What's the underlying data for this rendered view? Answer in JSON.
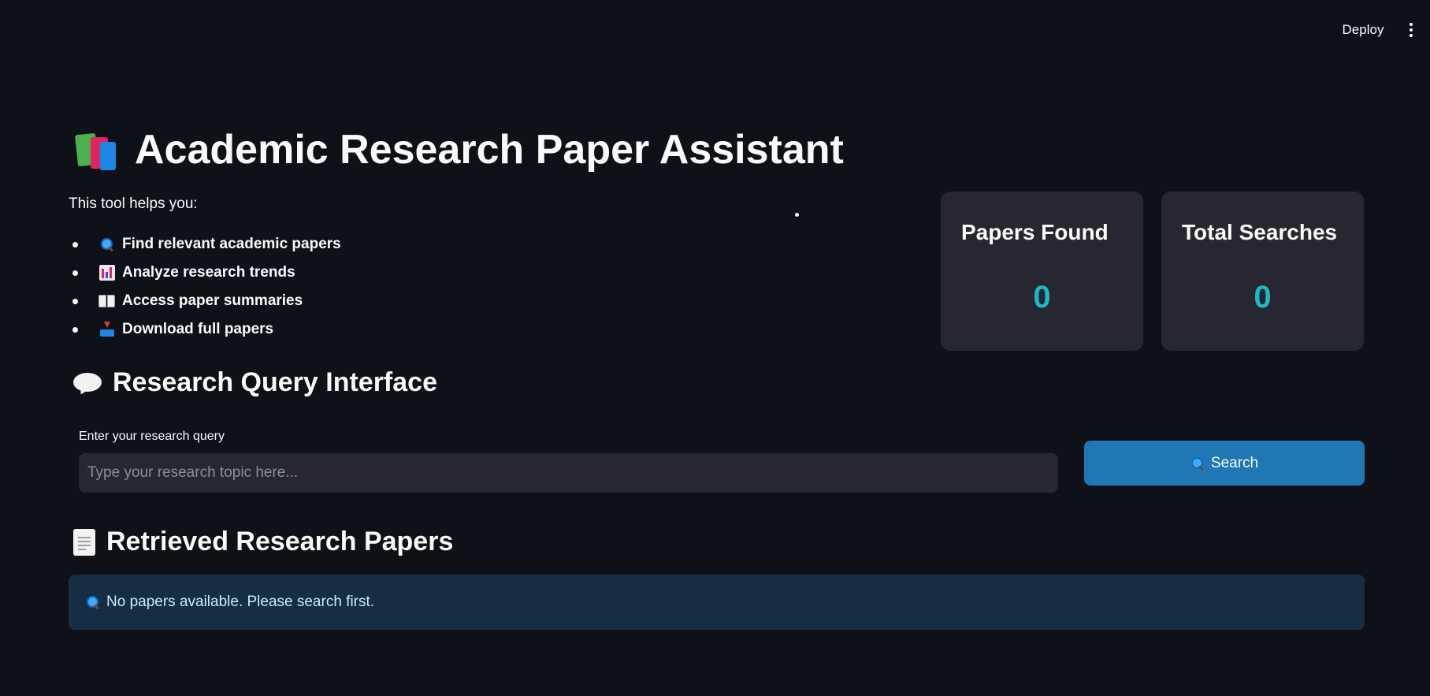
{
  "header": {
    "deploy_label": "Deploy"
  },
  "page": {
    "title": "Academic Research Paper Assistant",
    "title_icon": "books-icon",
    "intro": "This tool helps you:",
    "features": [
      {
        "icon": "magnifier-icon",
        "label": "Find relevant academic papers"
      },
      {
        "icon": "bar-chart-icon",
        "label": "Analyze research trends"
      },
      {
        "icon": "open-book-icon",
        "label": "Access paper summaries"
      },
      {
        "icon": "inbox-tray-icon",
        "label": "Download full papers"
      }
    ]
  },
  "metrics": [
    {
      "label": "Papers Found",
      "value": "0"
    },
    {
      "label": "Total Searches",
      "value": "0"
    }
  ],
  "query_section": {
    "heading": "Research Query Interface",
    "heading_icon": "speech-bubble-icon",
    "input_label": "Enter your research query",
    "input_value": "",
    "input_placeholder": "Type your research topic here...",
    "search_label": "Search",
    "search_icon": "magnifier-icon"
  },
  "results_section": {
    "heading": "Retrieved Research Papers",
    "heading_icon": "page-icon",
    "empty_message": "No papers available. Please search first.",
    "empty_icon": "magnifier-icon"
  },
  "colors": {
    "background": "#0e1117",
    "card": "#262730",
    "metric_value": "#1cb8c4",
    "primary_button": "#1f77b4",
    "info_box": "#172d43",
    "info_text": "#c7ebff"
  }
}
